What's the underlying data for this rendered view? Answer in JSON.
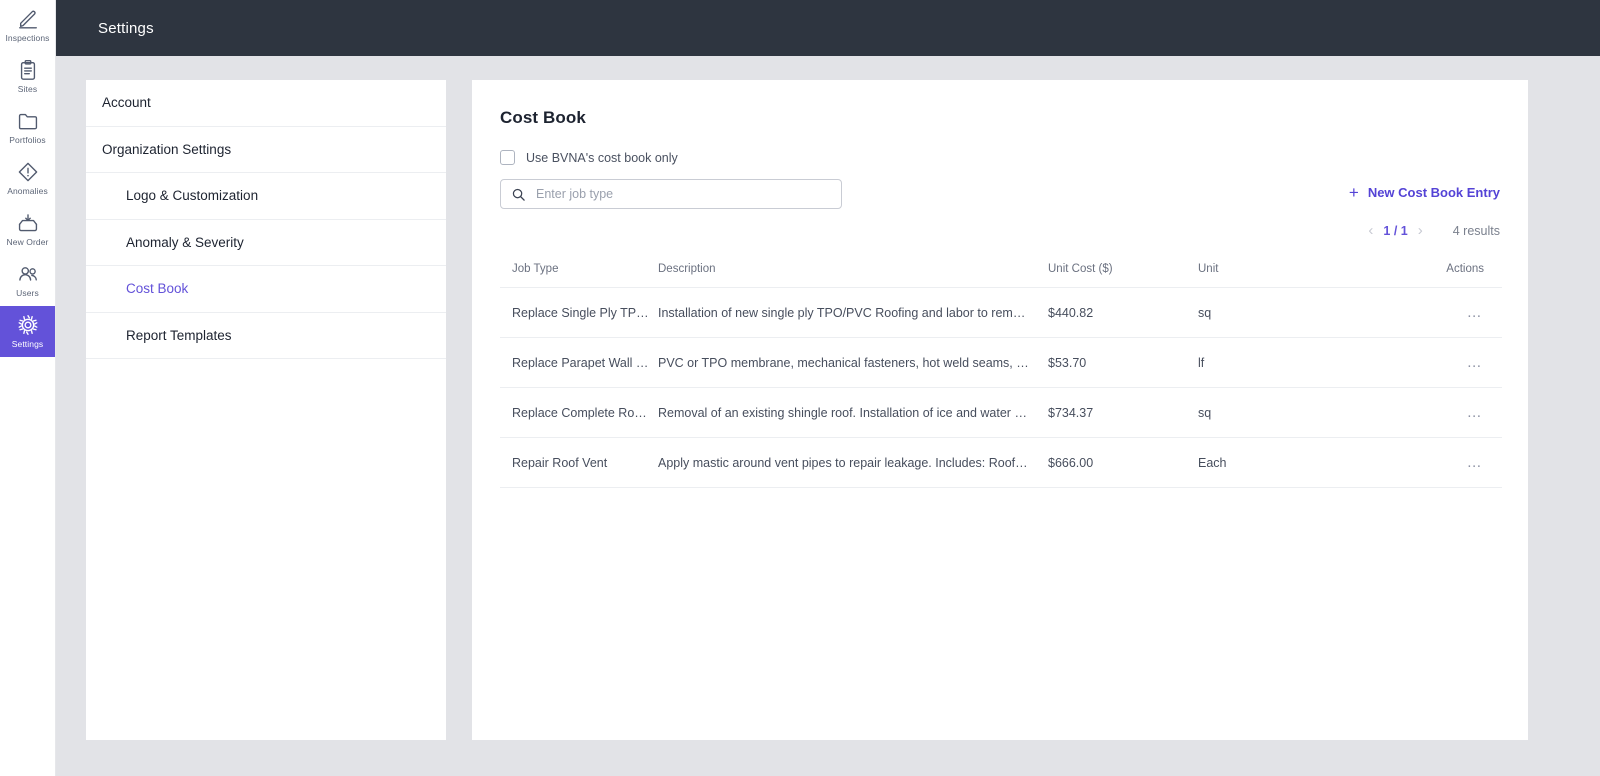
{
  "colors": {
    "accent": "#6352d9",
    "topbar_bg": "#2e3540",
    "workspace_bg": "#e2e3e7",
    "card_bg": "#ffffff",
    "divider": "#eceef1",
    "muted_text": "#6b7180"
  },
  "rail": {
    "items": [
      {
        "label": "Inspections",
        "icon": "pencil-icon",
        "active": false
      },
      {
        "label": "Sites",
        "icon": "clipboard-icon",
        "active": false
      },
      {
        "label": "Portfolios",
        "icon": "folder-icon",
        "active": false
      },
      {
        "label": "Anomalies",
        "icon": "diamond-alert-icon",
        "active": false
      },
      {
        "label": "New Order",
        "icon": "inbox-download-icon",
        "active": false
      },
      {
        "label": "Users",
        "icon": "users-icon",
        "active": false
      },
      {
        "label": "Settings",
        "icon": "gear-icon",
        "active": true
      }
    ]
  },
  "topbar": {
    "title": "Settings"
  },
  "settings_nav": {
    "items": [
      {
        "label": "Account",
        "level": 0,
        "selected": false
      },
      {
        "label": "Organization Settings",
        "level": 0,
        "selected": false
      },
      {
        "label": "Logo & Customization",
        "level": 1,
        "selected": false
      },
      {
        "label": "Anomaly & Severity",
        "level": 1,
        "selected": false
      },
      {
        "label": "Cost Book",
        "level": 1,
        "selected": true
      },
      {
        "label": "Report Templates",
        "level": 1,
        "selected": false
      }
    ]
  },
  "main": {
    "title": "Cost Book",
    "checkbox": {
      "label": "Use BVNA's cost book only",
      "checked": false
    },
    "search": {
      "value": "",
      "placeholder": "Enter job type",
      "icon": "search-icon"
    },
    "new_entry_button": {
      "label": "New Cost Book Entry",
      "icon": "plus-icon"
    },
    "pagination": {
      "prev_icon": "chevron-left-icon",
      "next_icon": "chevron-right-icon",
      "page_label": "1 / 1",
      "results_label": "4 results"
    },
    "table": {
      "columns": [
        "Job Type",
        "Description",
        "Unit Cost ($)",
        "Unit",
        "Actions"
      ],
      "rows": [
        {
          "job_type": "Replace Single Ply TP…",
          "description": "Installation of new single ply TPO/PVC Roofing and labor to remove …",
          "unit_cost": "$440.82",
          "unit": "sq",
          "actions": "…"
        },
        {
          "job_type": "Replace Parapet Wall …",
          "description": "PVC or TPO membrane, mechanical fasteners, hot weld seams, and i…",
          "unit_cost": "$53.70",
          "unit": "lf",
          "actions": "…"
        },
        {
          "job_type": "Replace Complete Ro…",
          "description": "Removal of an existing shingle roof. Installation of ice and water shie…",
          "unit_cost": "$734.37",
          "unit": "sq",
          "actions": "…"
        },
        {
          "job_type": "Repair Roof Vent",
          "description": "Apply mastic around vent pipes to repair leakage. Includes: Roofing c…",
          "unit_cost": "$666.00",
          "unit": "Each",
          "actions": "…"
        }
      ]
    }
  }
}
